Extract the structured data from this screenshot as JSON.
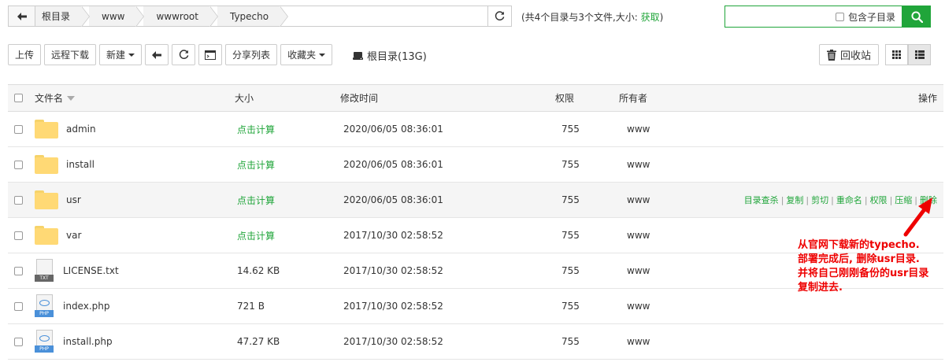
{
  "pathbar": {
    "crumbs": [
      "根目录",
      "www",
      "wwwroot",
      "Typecho"
    ]
  },
  "summary": {
    "text": "(共4个目录与3个文件,大小: ",
    "link": "获取",
    "close": ")"
  },
  "search": {
    "subdir_label": "包含子目录"
  },
  "toolbar": {
    "upload": "上传",
    "remote_download": "远程下载",
    "new": "新建",
    "share_list": "分享列表",
    "favorites": "收藏夹"
  },
  "disk_label": "根目录(13G)",
  "recycle_label": "回收站",
  "table": {
    "headers": {
      "name": "文件名",
      "size": "大小",
      "mtime": "修改时间",
      "perm": "权限",
      "owner": "所有者",
      "ops": "操作"
    },
    "rows": [
      {
        "name": "admin",
        "type": "folder",
        "size": "点击计算",
        "mtime": "2020/06/05 08:36:01",
        "perm": "755",
        "owner": "www"
      },
      {
        "name": "install",
        "type": "folder",
        "size": "点击计算",
        "mtime": "2020/06/05 08:36:01",
        "perm": "755",
        "owner": "www"
      },
      {
        "name": "usr",
        "type": "folder",
        "size": "点击计算",
        "mtime": "2020/06/05 08:36:01",
        "perm": "755",
        "owner": "www"
      },
      {
        "name": "var",
        "type": "folder",
        "size": "点击计算",
        "mtime": "2017/10/30 02:58:52",
        "perm": "755",
        "owner": "www"
      },
      {
        "name": "LICENSE.txt",
        "type": "txt",
        "size": "14.62 KB",
        "mtime": "2017/10/30 02:58:52",
        "perm": "755",
        "owner": "www"
      },
      {
        "name": "index.php",
        "type": "php",
        "size": "721 B",
        "mtime": "2017/10/30 02:58:52",
        "perm": "755",
        "owner": "www"
      },
      {
        "name": "install.php",
        "type": "php",
        "size": "47.27 KB",
        "mtime": "2017/10/30 02:58:52",
        "perm": "755",
        "owner": "www"
      }
    ],
    "row_ops": [
      "目录查杀",
      "复制",
      "剪切",
      "重命名",
      "权限",
      "压缩",
      "删除"
    ]
  },
  "annotation": {
    "lines": [
      "从官网下载新的typecho.",
      "部署完成后, 删除usr目录.",
      "并将自己刚刚备份的usr目录",
      "复制进去."
    ],
    "color": "#ee0000"
  },
  "colors": {
    "accent": "#20a53a",
    "folder": "#ffd975"
  }
}
